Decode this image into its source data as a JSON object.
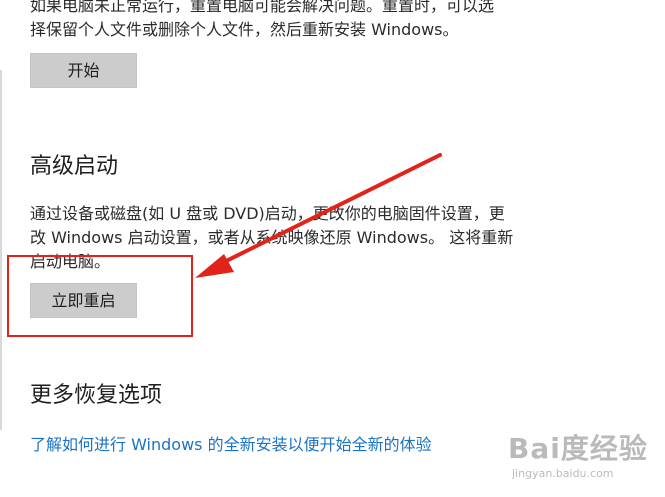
{
  "reset": {
    "description_line1": "如果电脑未正常运行，重置电脑可能会解决问题。重置时，可以选",
    "description_line2": "择保留个人文件或删除个人文件，然后重新安装 Windows。",
    "button_label": "开始"
  },
  "advanced": {
    "title": "高级启动",
    "description_line1": "通过设备或磁盘(如 U 盘或 DVD)启动，更改你的电脑固件设置，更",
    "description_line2": "改 Windows 启动设置，或者从系统映像还原 Windows。 这将重新",
    "description_line3": "启动电脑。",
    "button_label": "立即重启"
  },
  "more": {
    "title": "更多恢复选项",
    "link_label": "了解如何进行 Windows 的全新安装以便开始全新的体验"
  },
  "watermark": {
    "logo": "Bai度经验",
    "url": "jingyan.baidu.com"
  },
  "colors": {
    "accent_link": "#1a73c6",
    "annotation": "#e2231a",
    "button_bg": "#cccccc"
  }
}
